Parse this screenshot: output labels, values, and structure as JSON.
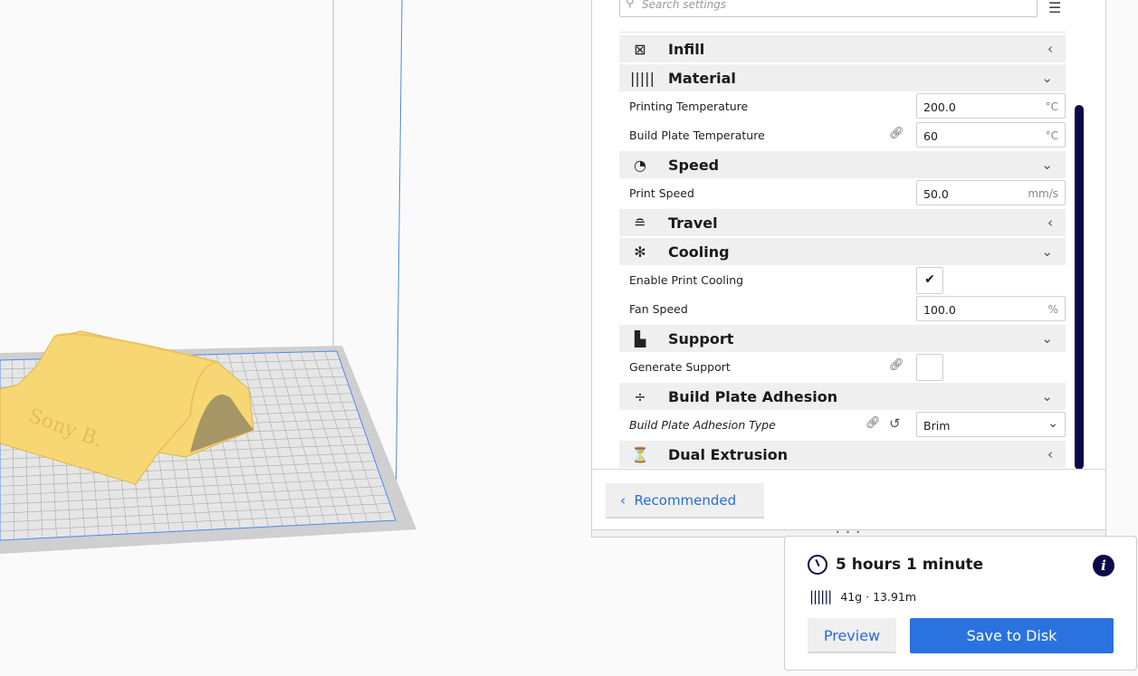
{
  "search": {
    "placeholder": "Search settings"
  },
  "categories": [
    {
      "label": "Infill",
      "icon": "infill-icon",
      "expanded": false
    },
    {
      "label": "Material",
      "icon": "material-icon",
      "expanded": true
    },
    {
      "label": "Speed",
      "icon": "speed-icon",
      "expanded": true
    },
    {
      "label": "Travel",
      "icon": "travel-icon",
      "expanded": false
    },
    {
      "label": "Cooling",
      "icon": "cooling-icon",
      "expanded": true
    },
    {
      "label": "Support",
      "icon": "support-icon",
      "expanded": true
    },
    {
      "label": "Build Plate Adhesion",
      "icon": "adhesion-icon",
      "expanded": true
    },
    {
      "label": "Dual Extrusion",
      "icon": "dual-extrusion-icon",
      "expanded": false
    }
  ],
  "settings": {
    "printing_temperature": {
      "label": "Printing Temperature",
      "value": "200.0",
      "unit": "°C"
    },
    "build_plate_temperature": {
      "label": "Build Plate Temperature",
      "value": "60",
      "unit": "°C"
    },
    "print_speed": {
      "label": "Print Speed",
      "value": "50.0",
      "unit": "mm/s"
    },
    "enable_print_cooling": {
      "label": "Enable Print Cooling",
      "checked": true
    },
    "fan_speed": {
      "label": "Fan Speed",
      "value": "100.0",
      "unit": "%"
    },
    "generate_support": {
      "label": "Generate Support",
      "checked": false
    },
    "adhesion_type": {
      "label": "Build Plate Adhesion Type",
      "value": "Brim"
    }
  },
  "recommended_label": "Recommended",
  "summary": {
    "time": "5 hours 1 minute",
    "material": "41g · 13.91m",
    "preview_label": "Preview",
    "save_label": "Save to Disk"
  },
  "model": {
    "text": "Sony B."
  },
  "colors": {
    "accent": "#2a72e0",
    "scrollbar": "#0a0a4a",
    "model": "#f7d774"
  }
}
